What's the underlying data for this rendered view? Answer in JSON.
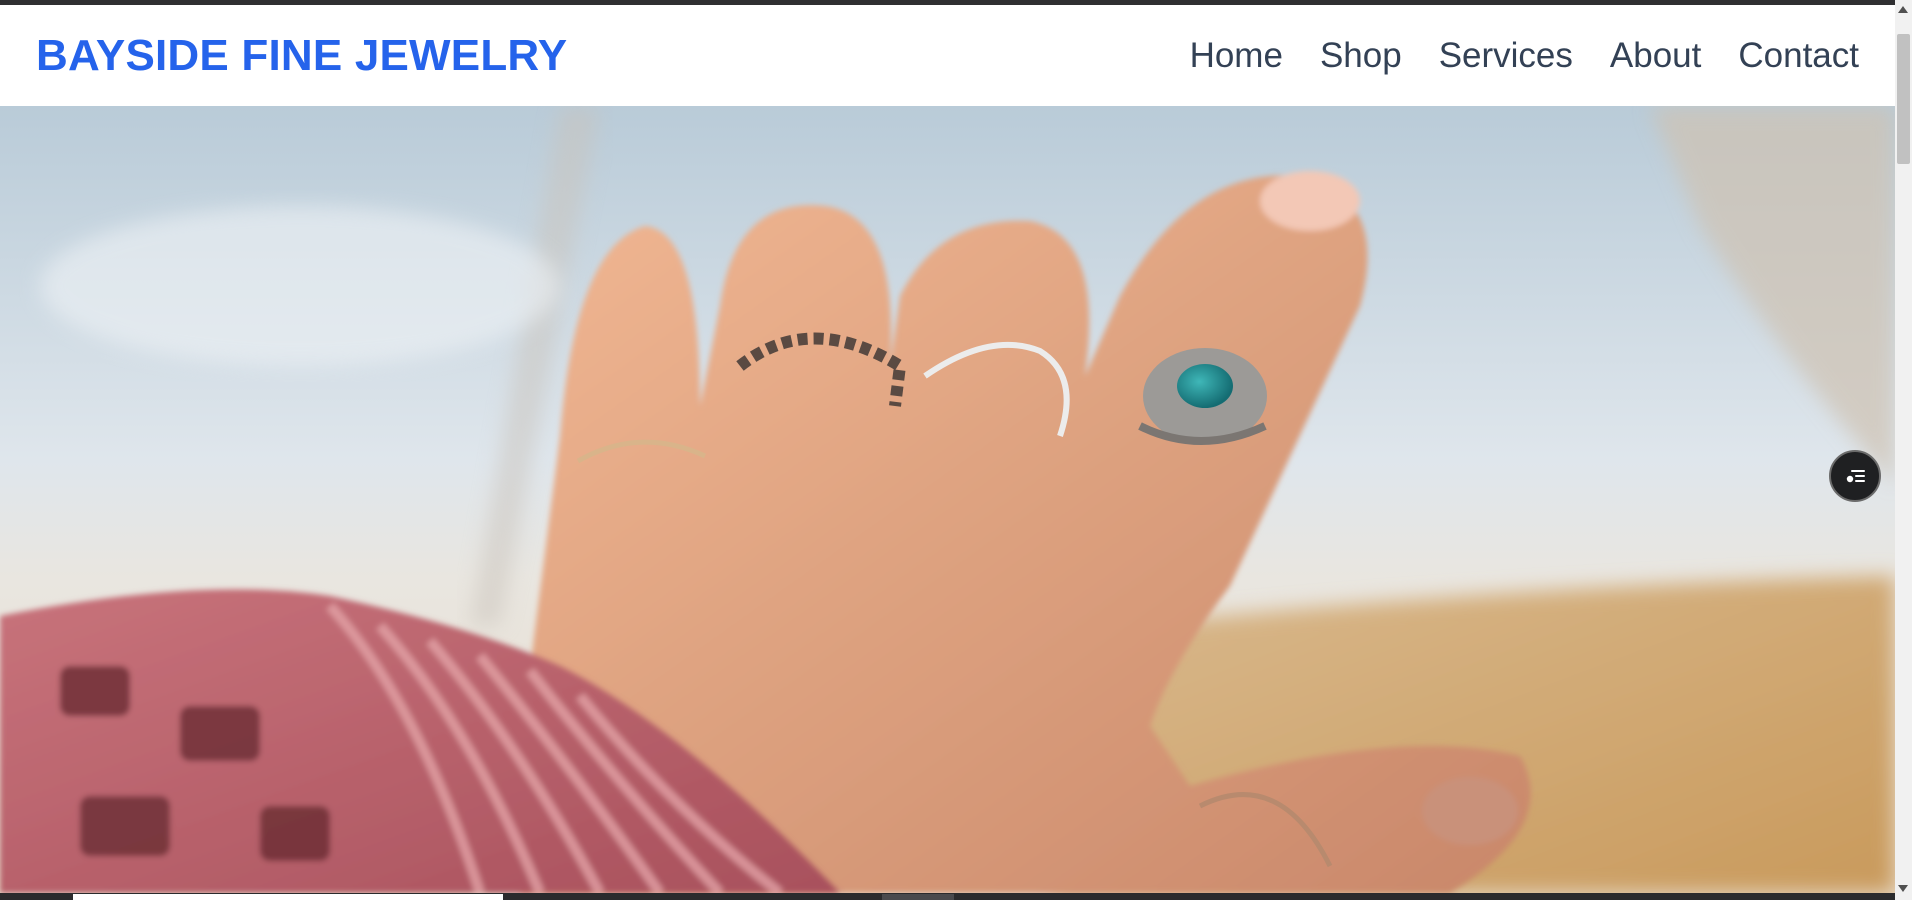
{
  "header": {
    "brand": "BAYSIDE FINE JEWELRY",
    "nav": [
      {
        "label": "Home"
      },
      {
        "label": "Shop"
      },
      {
        "label": "Services"
      },
      {
        "label": "About"
      },
      {
        "label": "Contact"
      }
    ]
  },
  "hero": {
    "image": "hand-with-silver-rings-photo"
  },
  "floating_button": {
    "icon": "menu-list-icon"
  },
  "colors": {
    "brand": "#2563eb",
    "nav_text": "#334155"
  }
}
